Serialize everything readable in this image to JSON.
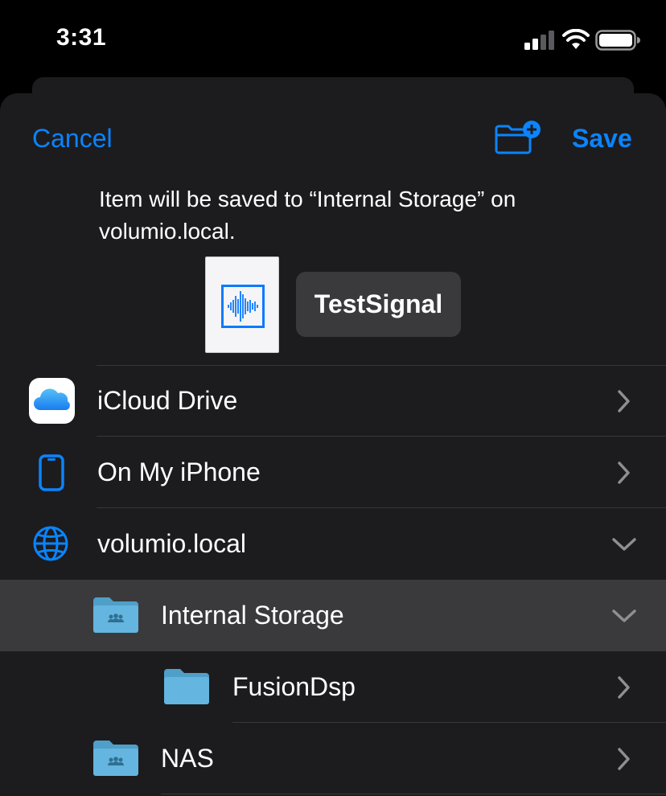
{
  "status_bar": {
    "time": "3:31",
    "signal_icon": "cellular-signal-icon",
    "wifi_icon": "wifi-icon",
    "battery_icon": "battery-icon"
  },
  "nav": {
    "cancel_label": "Cancel",
    "save_label": "Save",
    "new_folder_icon": "folder-plus-icon"
  },
  "info_text": "Item will be saved to “Internal Storage” on volumio.local.",
  "file": {
    "name": "TestSignal",
    "thumbnail_icon": "audio-waveform-icon"
  },
  "locations": [
    {
      "label": "iCloud Drive",
      "icon": "icloud-icon",
      "accessory": "chevron-right"
    },
    {
      "label": "On My iPhone",
      "icon": "iphone-icon",
      "accessory": "chevron-right"
    },
    {
      "label": "volumio.local",
      "icon": "globe-icon",
      "accessory": "chevron-down"
    },
    {
      "label": "Internal Storage",
      "icon": "shared-folder-icon",
      "accessory": "chevron-down",
      "selected": true
    },
    {
      "label": "FusionDsp",
      "icon": "folder-icon",
      "accessory": "chevron-right"
    },
    {
      "label": "NAS",
      "icon": "shared-folder-icon",
      "accessory": "chevron-right"
    }
  ],
  "colors": {
    "accent": "#0a84ff",
    "sheet_bg": "#1c1c1e",
    "selected_row": "#3a3a3c",
    "folder": "#5fb0dc"
  }
}
